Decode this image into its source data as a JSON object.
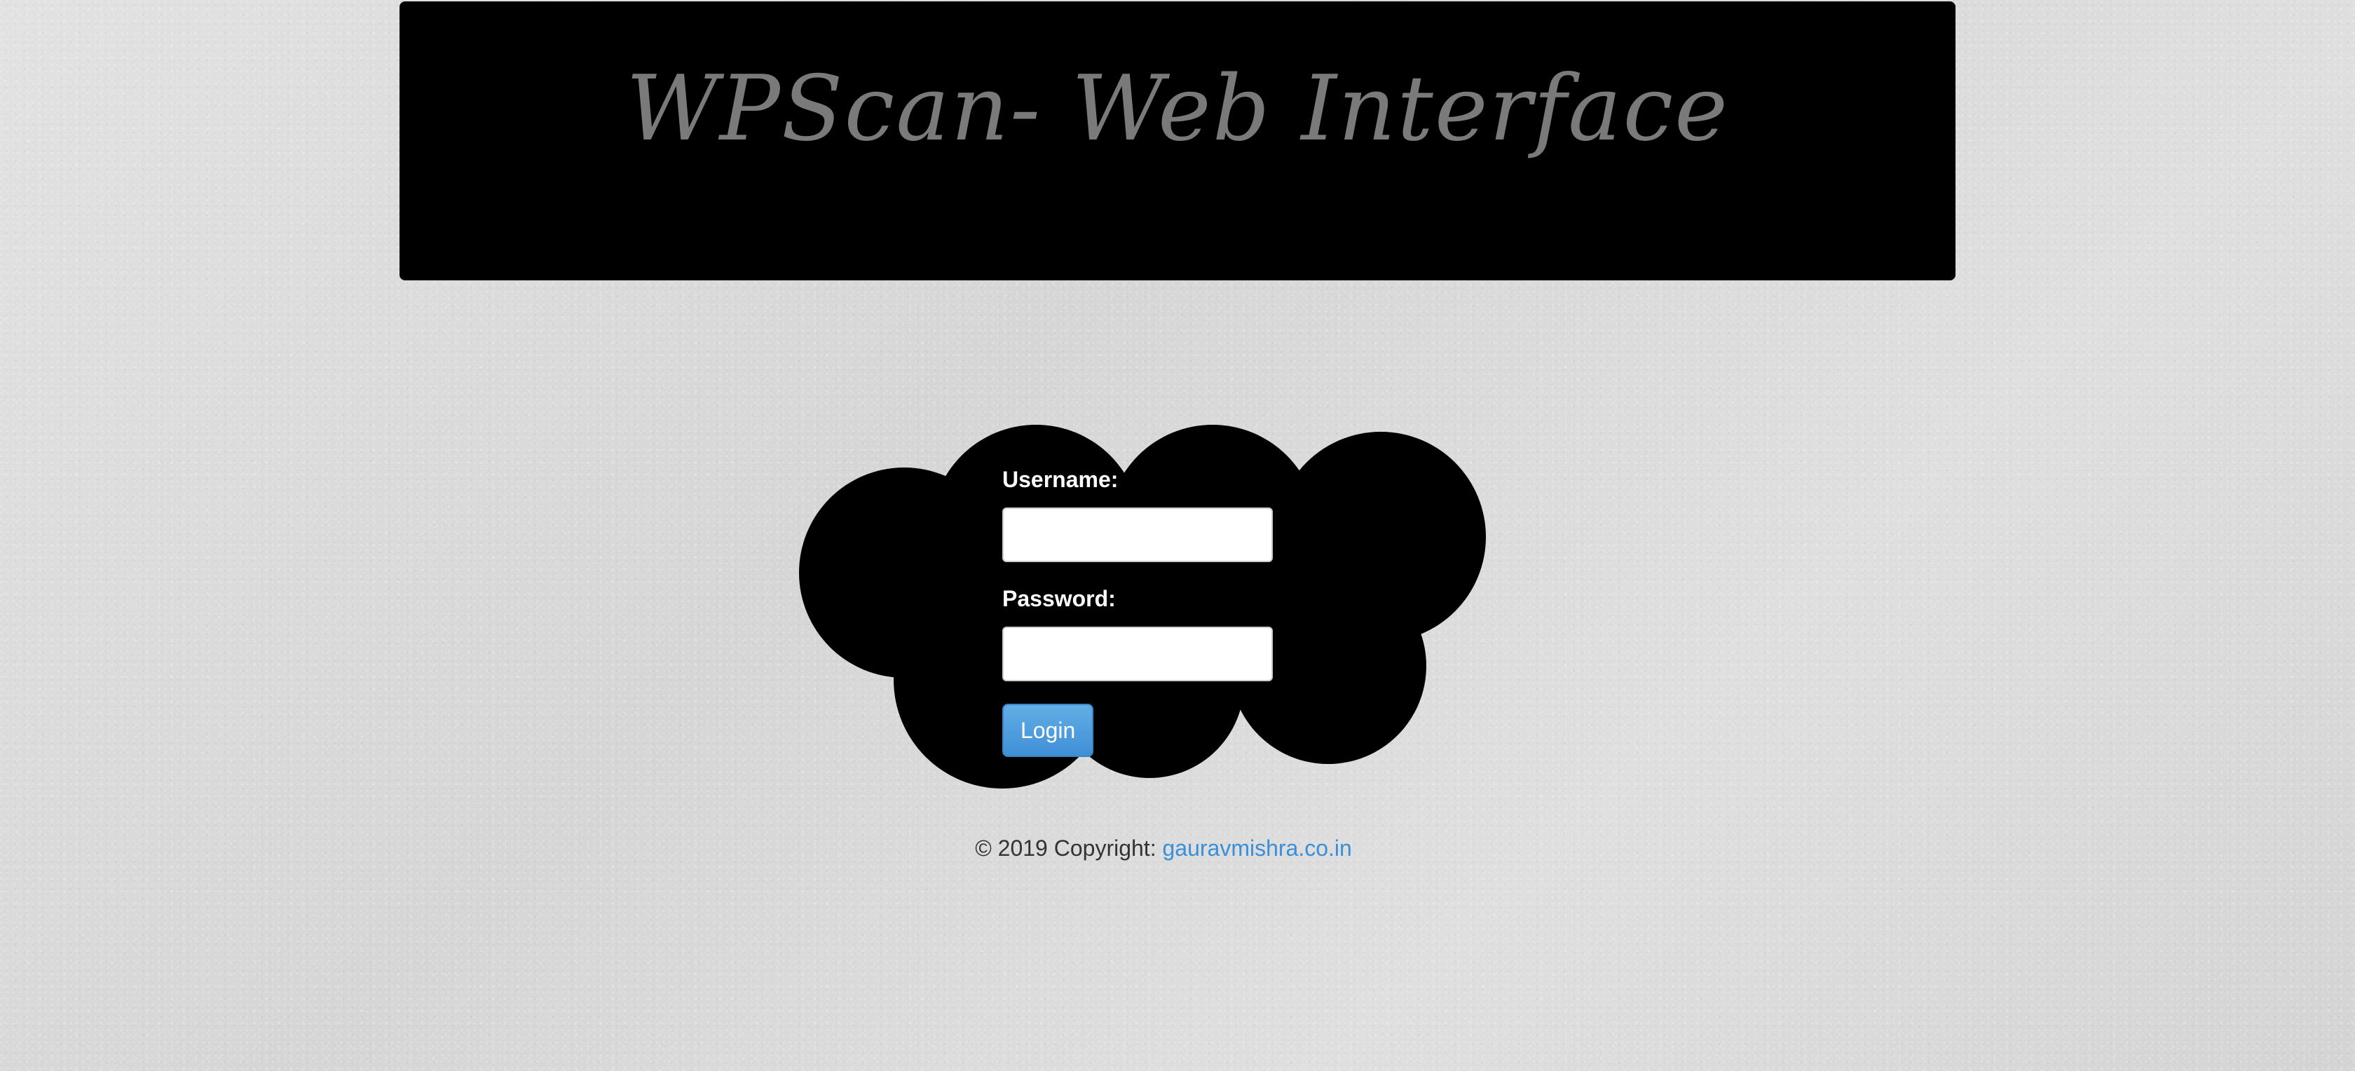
{
  "header": {
    "title": "WPScan- Web Interface"
  },
  "login": {
    "username_label": "Username:",
    "username_value": "",
    "password_label": "Password:",
    "password_value": "",
    "submit_label": "Login"
  },
  "footer": {
    "copyright_text": "© 2019 Copyright: ",
    "link_text": "gauravmishra.co.in"
  },
  "colors": {
    "banner_background": "#000000",
    "title_text": "#7a7a7a",
    "cloud": "#000000",
    "button_background": "#4a9be0",
    "link": "#3a8fd9",
    "page_background": "#d9d9d9"
  }
}
